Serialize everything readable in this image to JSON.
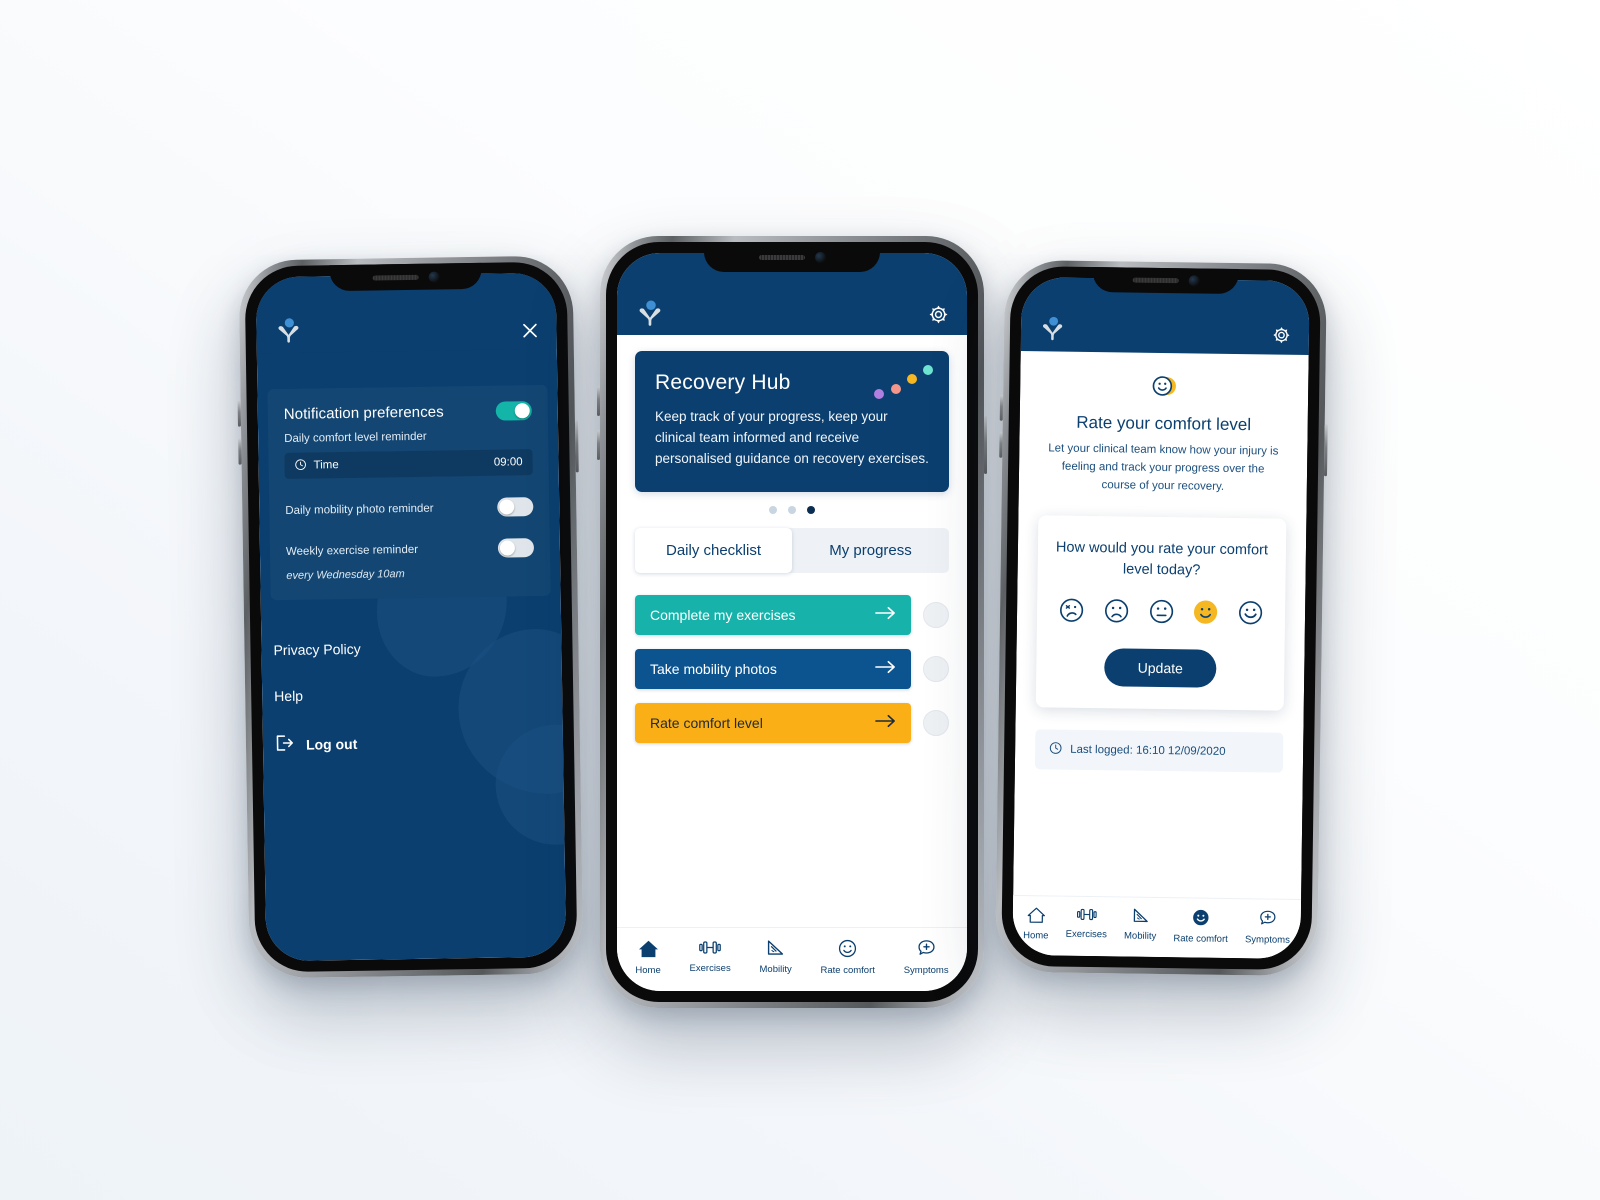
{
  "colors": {
    "brand_navy": "#0b3f6f",
    "deep_navy": "#0b2d52",
    "teal": "#17b3ab",
    "blue": "#0c5490",
    "amber": "#fbaf17",
    "toggle_on": "#12b5a8",
    "page_bg": "#f1f5f9"
  },
  "left_phone": {
    "header": {
      "logo": "app-logo",
      "close": "close-icon"
    },
    "preferences": {
      "title": "Notification preferences",
      "master_toggle_on": true,
      "reminder_label": "Daily comfort level reminder",
      "time_label": "Time",
      "time_value": "09:00",
      "time_icon": "clock-icon",
      "rows": [
        {
          "label": "Daily mobility photo reminder",
          "on": false
        },
        {
          "label": "Weekly exercise reminder",
          "on": false
        }
      ],
      "weekly_note": "every Wednesday 10am"
    },
    "menu": [
      {
        "label": "Privacy Policy"
      },
      {
        "label": "Help"
      }
    ],
    "logout": {
      "label": "Log out",
      "icon": "logout-icon"
    }
  },
  "center_phone": {
    "header": {
      "logo": "app-logo",
      "settings": "gear-icon"
    },
    "hub": {
      "title": "Recovery Hub",
      "body": "Keep track of your progress, keep your clinical team informed and receive personalised guidance on recovery exercises.",
      "decor_dots": [
        "#b17fe0",
        "#f5968b",
        "#f5b722",
        "#6fe3d2"
      ]
    },
    "carousel": {
      "count": 3,
      "active_index": 2
    },
    "tabs": [
      {
        "label": "Daily checklist",
        "active": true
      },
      {
        "label": "My progress",
        "active": false
      }
    ],
    "tasks": [
      {
        "label": "Complete my exercises",
        "color": "#17b3ab",
        "text_color": "#ffffff",
        "checked": false
      },
      {
        "label": "Take mobility photos",
        "color": "#0c5490",
        "text_color": "#ffffff",
        "checked": false
      },
      {
        "label": "Rate comfort level",
        "color": "#fbaf17",
        "text_color": "#1c2b3a",
        "checked": false
      }
    ],
    "tabbar": [
      {
        "label": "Home",
        "icon": "home-icon",
        "active": true
      },
      {
        "label": "Exercises",
        "icon": "dumbbell-icon",
        "active": false
      },
      {
        "label": "Mobility",
        "icon": "protractor-icon",
        "active": false
      },
      {
        "label": "Rate comfort",
        "icon": "smiley-icon",
        "active": false
      },
      {
        "label": "Symptoms",
        "icon": "speech-plus-icon",
        "active": false
      }
    ]
  },
  "right_phone": {
    "header": {
      "logo": "app-logo",
      "settings": "gear-icon"
    },
    "hero_icon": "smiley-badge-icon",
    "title": "Rate your comfort level",
    "subtitle": "Let your clinical team know how your injury is feeling and track your progress over the course of your recovery.",
    "card": {
      "question": "How would you rate your comfort level today?",
      "faces": [
        {
          "name": "very-sad-face",
          "selected": false
        },
        {
          "name": "sad-face",
          "selected": false
        },
        {
          "name": "neutral-face",
          "selected": false
        },
        {
          "name": "happy-face",
          "selected": true
        },
        {
          "name": "very-happy-face",
          "selected": false
        }
      ],
      "update_label": "Update"
    },
    "last_logged": {
      "icon": "clock-icon",
      "text": "Last logged: 16:10 12/09/2020"
    },
    "tabbar": [
      {
        "label": "Home",
        "icon": "home-icon",
        "active": false
      },
      {
        "label": "Exercises",
        "icon": "dumbbell-icon",
        "active": false
      },
      {
        "label": "Mobility",
        "icon": "protractor-icon",
        "active": false
      },
      {
        "label": "Rate comfort",
        "icon": "smiley-icon",
        "active": true
      },
      {
        "label": "Symptoms",
        "icon": "speech-plus-icon",
        "active": false
      }
    ]
  }
}
